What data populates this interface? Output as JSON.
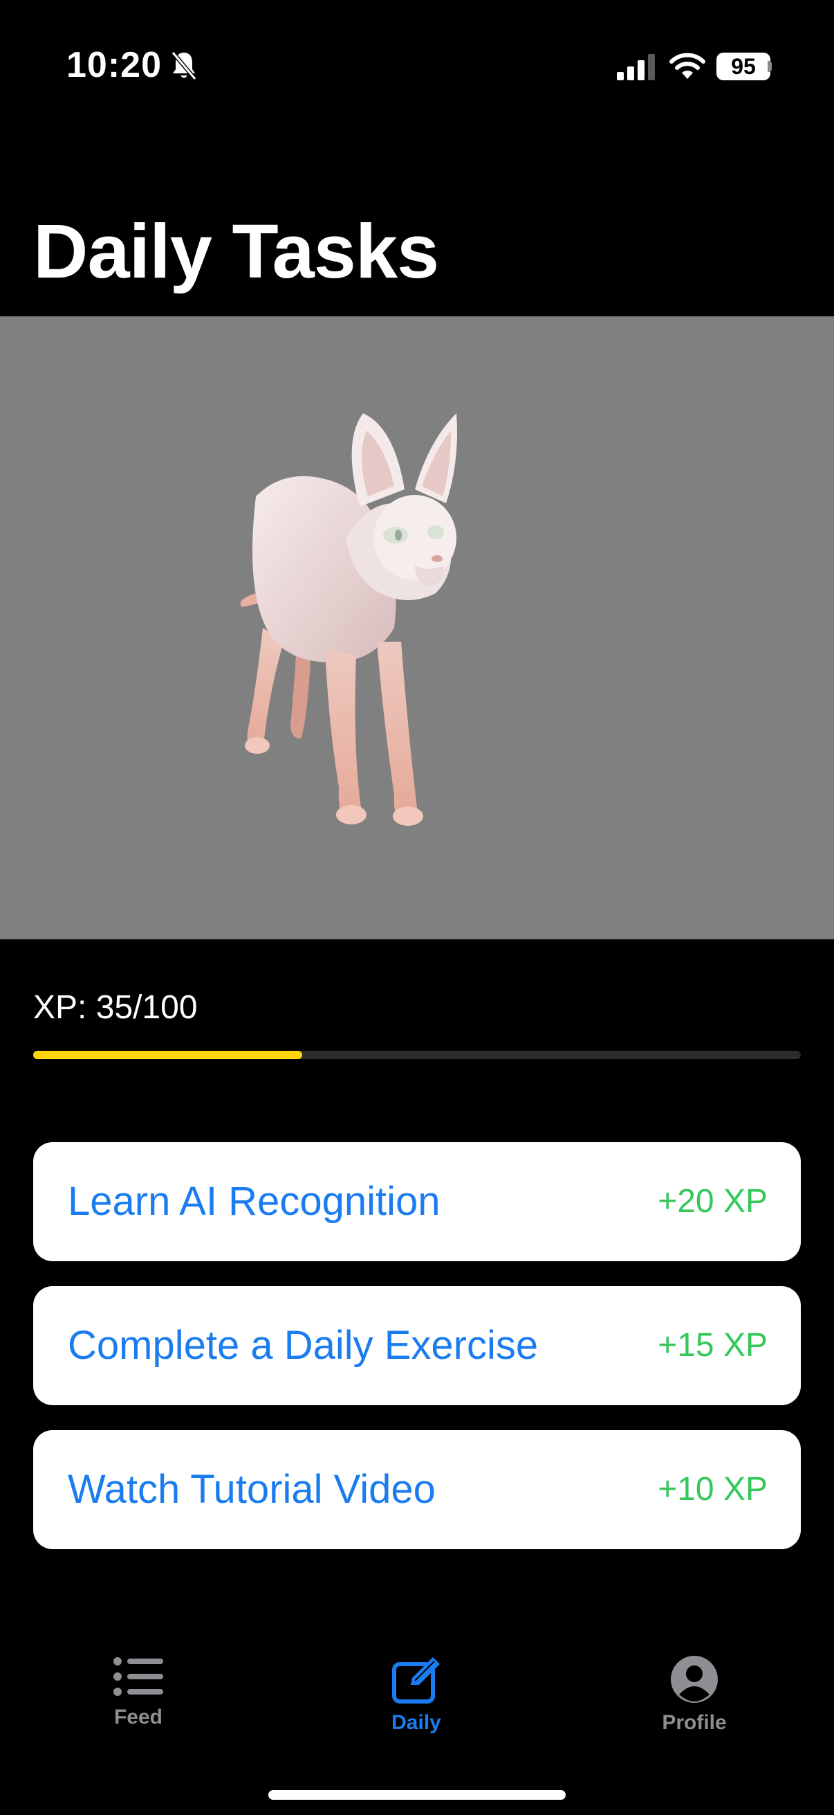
{
  "status_bar": {
    "time": "10:20",
    "battery": "95"
  },
  "page": {
    "title": "Daily Tasks"
  },
  "xp": {
    "label": "XP: 35/100",
    "current": 35,
    "max": 100,
    "progress_fraction": 0.35,
    "bar_color": "#ffd60a"
  },
  "tasks": [
    {
      "title": "Learn AI Recognition",
      "reward": "+20 XP"
    },
    {
      "title": "Complete a Daily Exercise",
      "reward": "+15 XP"
    },
    {
      "title": "Watch Tutorial Video",
      "reward": "+10 XP"
    }
  ],
  "tabbar": {
    "items": [
      {
        "label": "Feed",
        "icon": "list-icon",
        "active": false
      },
      {
        "label": "Daily",
        "icon": "square-pencil-icon",
        "active": true
      },
      {
        "label": "Profile",
        "icon": "person-circle-icon",
        "active": false
      }
    ],
    "active_color": "#1a7cf0",
    "inactive_color": "#8e8e93"
  },
  "colors": {
    "accent": "#1a7cf0",
    "reward": "#34c759",
    "preview_background": "#808080"
  }
}
